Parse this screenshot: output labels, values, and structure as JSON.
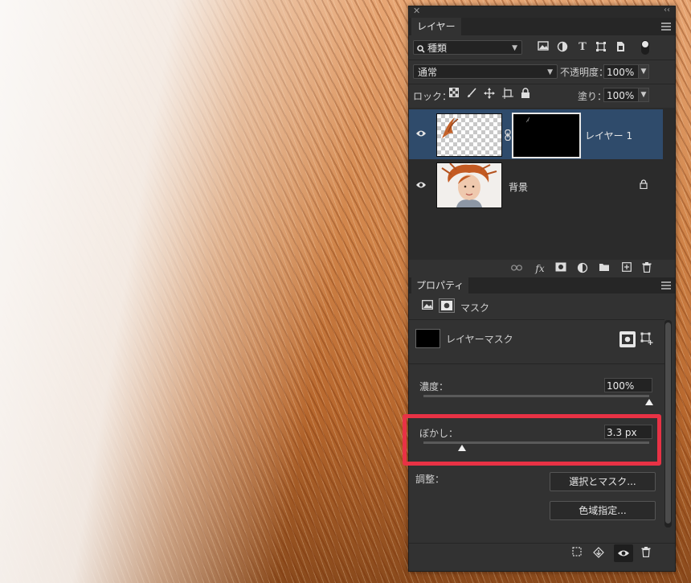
{
  "layers_panel": {
    "tab_label": "レイヤー",
    "filter_kind": "種類",
    "blend_mode": "通常",
    "opacity_label": "不透明度：",
    "opacity_value": "100%",
    "lock_label": "ロック：",
    "fill_label": "塗り：",
    "fill_value": "100%",
    "layers": [
      {
        "name": "レイヤー 1",
        "selected": true
      },
      {
        "name": "背景",
        "locked": true
      }
    ]
  },
  "properties_panel": {
    "tab_label": "プロパティ",
    "mask_section_label": "マスク",
    "layer_mask_label": "レイヤーマスク",
    "density_label": "濃度：",
    "density_value": "100%",
    "density_level": 1.0,
    "feather_label": "ぼかし：",
    "feather_value": "3.3 px",
    "feather_level": 0.17,
    "adjust_label": "調整：",
    "select_and_mask_button": "選択とマスク...",
    "color_range_button": "色域指定..."
  },
  "colors": {
    "panel_bg": "#323232",
    "selected_layer": "#2f4b6b",
    "highlight_border": "#e83245"
  }
}
